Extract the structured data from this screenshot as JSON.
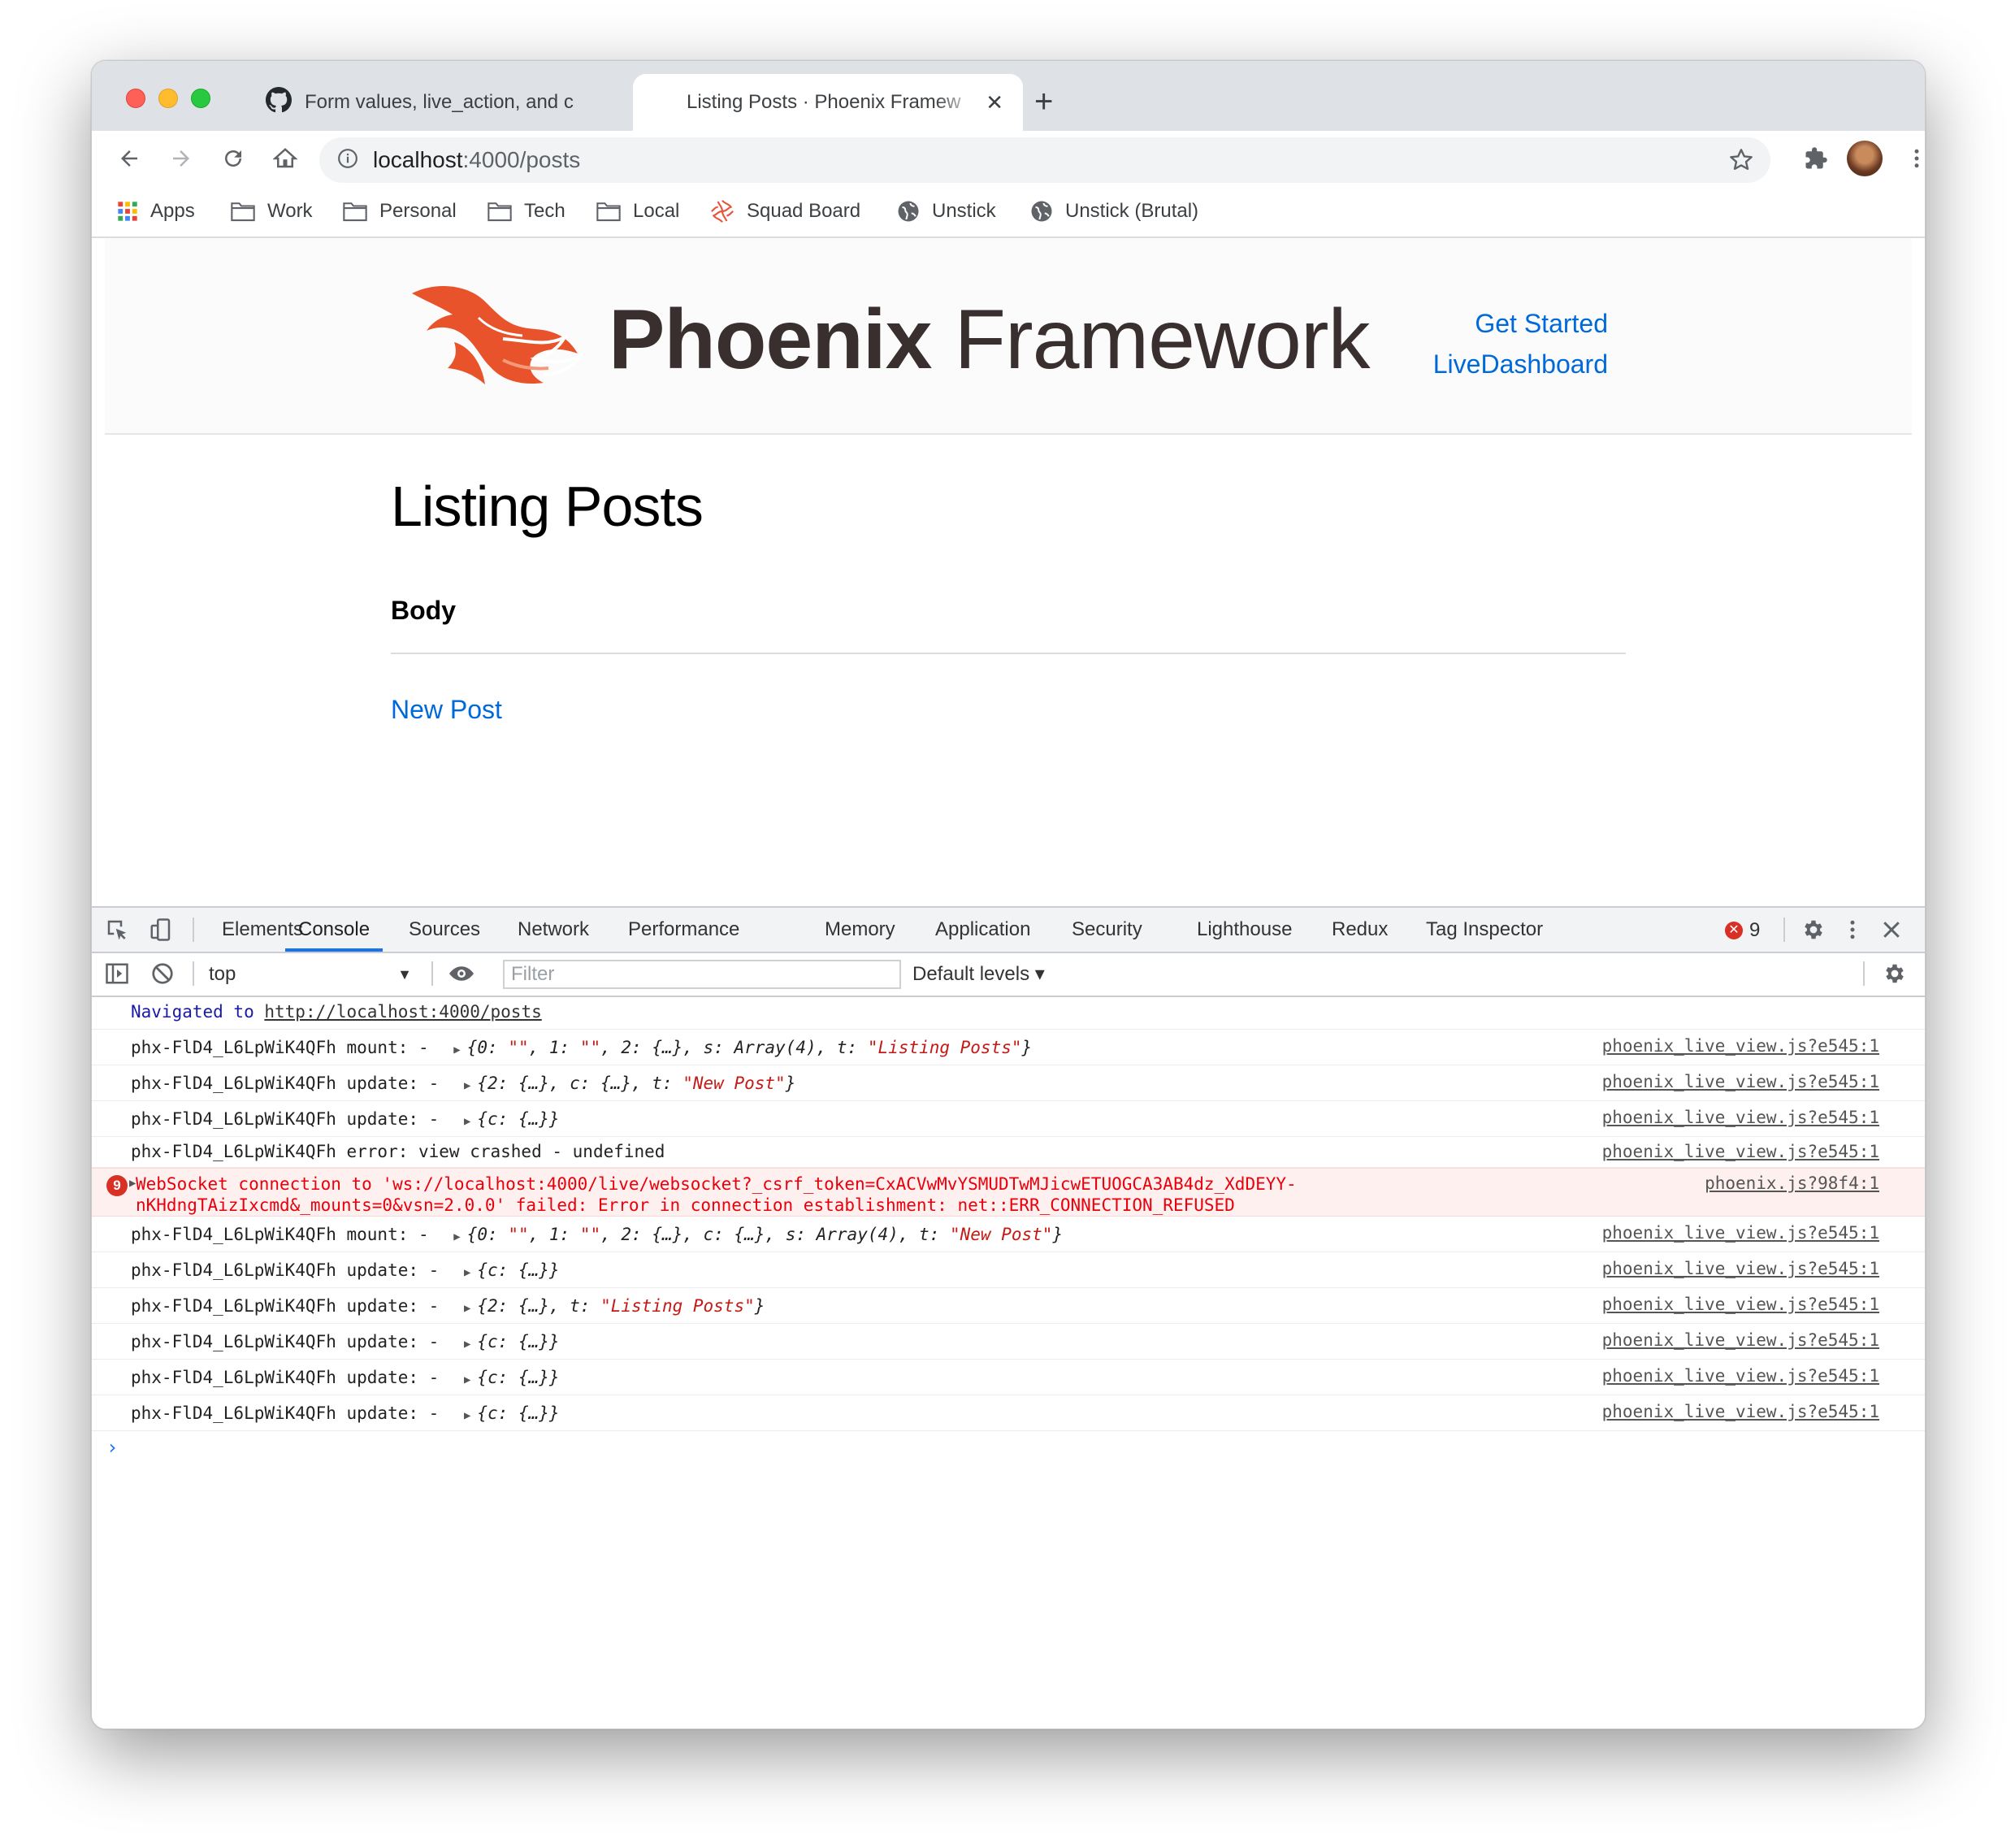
{
  "tabs": [
    {
      "title": "Form values, live_action, and c",
      "active": false
    },
    {
      "title": "Listing Posts · Phoenix Framew",
      "active": true
    }
  ],
  "toolbar": {
    "url_host": "localhost",
    "url_path": ":4000/posts"
  },
  "bookmarks": [
    {
      "label": "Apps",
      "icon": "apps-grid-icon"
    },
    {
      "label": "Work",
      "icon": "folder-icon"
    },
    {
      "label": "Personal",
      "icon": "folder-icon"
    },
    {
      "label": "Tech",
      "icon": "folder-icon"
    },
    {
      "label": "Local",
      "icon": "folder-icon"
    },
    {
      "label": "Squad Board",
      "icon": "squad-logo-icon"
    },
    {
      "label": "Unstick",
      "icon": "globe-icon"
    },
    {
      "label": "Unstick (Brutal)",
      "icon": "globe-icon"
    }
  ],
  "page": {
    "brand_bold": "Phoenix",
    "brand_light": "Framework",
    "nav": [
      "Get Started",
      "LiveDashboard"
    ],
    "title": "Listing Posts",
    "column_header": "Body",
    "new_post": "New Post"
  },
  "devtools": {
    "tabs": [
      "Elements",
      "Console",
      "Sources",
      "Network",
      "Performance",
      "Memory",
      "Application",
      "Security",
      "Lighthouse",
      "Redux",
      "Tag Inspector"
    ],
    "active_tab": "Console",
    "error_count": "9",
    "context": "top",
    "filter_placeholder": "Filter",
    "levels": "Default levels ▾",
    "log": {
      "nav_prefix": "Navigated to ",
      "nav_url": "http://localhost:4000/posts",
      "src_lv": "phoenix_live_view.js?e545:1",
      "src_px": "phoenix.js?98f4:1",
      "err_line1": "WebSocket connection to 'ws://localhost:4000/live/websocket?_csrf_token=CxACVwMvYSMUDTwMJicwETUOGCA3AB4dz_XdDEYY-",
      "err_line2": "nKHdngTAizIxcmd&_mounts=0&vsn=2.0.0' failed: Error in connection establishment: net::ERR_CONNECTION_REFUSED",
      "err_badge": "9",
      "crash_text": "phx-FlD4_L6LpWiK4QFh error: view crashed -  undefined"
    }
  },
  "colors": {
    "link": "#0069d9",
    "error_red": "#e8000a",
    "phoenix_orange": "#e8532b",
    "brand_text": "#3a2f2f",
    "devtools_active": "#1a73e8"
  }
}
